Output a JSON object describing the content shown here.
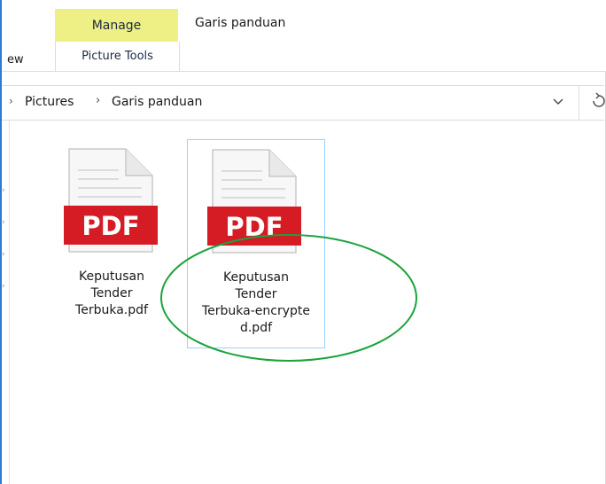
{
  "ribbon": {
    "manage_tab": "Manage",
    "window_title": "Garis panduan",
    "view_tab_partial": "ew",
    "picture_tools_tab": "Picture Tools"
  },
  "address": {
    "crumbs": [
      "Pictures",
      "Garis panduan"
    ],
    "separator": "›",
    "dropdown_icon": "chevron-down-icon",
    "refresh_icon": "refresh-icon"
  },
  "files": [
    {
      "name": "Keputusan\nTender\nTerbuka.pdf",
      "type_label": "PDF",
      "selected": false,
      "highlighted": false
    },
    {
      "name": "Keputusan\nTender\nTerbuka-encrypte\nd.pdf",
      "type_label": "PDF",
      "selected": true,
      "highlighted": true
    }
  ],
  "colors": {
    "manage_tab_bg": "#eef086",
    "pdf_red": "#d51b23",
    "selection_border": "#99d1ff",
    "annotation_green": "#1aa33c",
    "window_border": "#2b7bd4"
  }
}
